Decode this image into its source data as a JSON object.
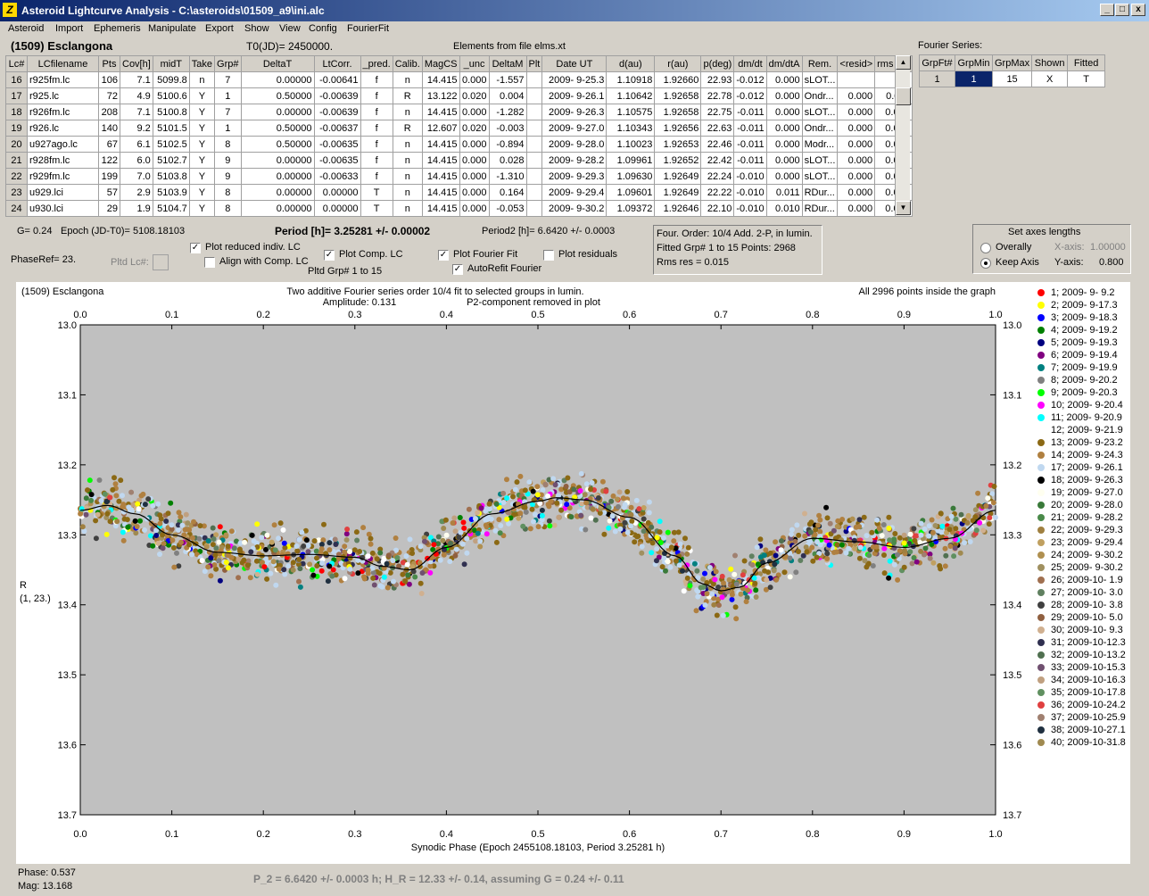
{
  "window": {
    "title": "Asteroid Lightcurve Analysis - C:\\asteroids\\01509_a9\\ini.alc",
    "app_icon": "zigzag-icon",
    "controls": [
      "_",
      "□",
      "x"
    ]
  },
  "menu": [
    "Asteroid",
    "Import",
    "Ephemeris",
    "Manipulate",
    "Export",
    "Show",
    "View",
    "Config",
    "FourierFit"
  ],
  "header": {
    "asteroid": "(1509) Esclangona",
    "t0": "T0(JD)= 2450000.",
    "elements": "Elements from file elms.xt",
    "fourier_title": "Fourier Series:"
  },
  "lc_table": {
    "columns": [
      "Lc#",
      "LCfilename",
      "Pts",
      "Cov[h]",
      "midT",
      "Take",
      "Grp#",
      "DeltaT",
      "LtCorr.",
      "_pred.",
      "Calib.",
      "MagCS",
      "_unc",
      "DeltaM",
      "Plt",
      "Date UT",
      "d(au)",
      "r(au)",
      "p(deg)",
      "dm/dt",
      "dm/dtA",
      "Rem.",
      "<resid>",
      "rms res"
    ],
    "rows": [
      [
        "16",
        "r925fm.lc",
        "106",
        "7.1",
        "5099.8",
        "n",
        "7",
        "0.00000",
        "-0.00641",
        "f",
        "n",
        "14.415",
        "0.000",
        "-1.557",
        "",
        "2009- 9-25.3",
        "1.10918",
        "1.92660",
        "22.93",
        "-0.012",
        "0.000",
        "sLOT...",
        "",
        ""
      ],
      [
        "17",
        "r925.lc",
        "72",
        "4.9",
        "5100.6",
        "Y",
        "1",
        "0.50000",
        "-0.00639",
        "f",
        "R",
        "13.122",
        "0.020",
        "0.004",
        "",
        "2009- 9-26.1",
        "1.10642",
        "1.92658",
        "22.78",
        "-0.012",
        "0.000",
        "Ondr...",
        "0.000",
        "0.011"
      ],
      [
        "18",
        "r926fm.lc",
        "208",
        "7.1",
        "5100.8",
        "Y",
        "7",
        "0.00000",
        "-0.00639",
        "f",
        "n",
        "14.415",
        "0.000",
        "-1.282",
        "",
        "2009- 9-26.3",
        "1.10575",
        "1.92658",
        "22.75",
        "-0.011",
        "0.000",
        "sLOT...",
        "0.000",
        "0.015"
      ],
      [
        "19",
        "r926.lc",
        "140",
        "9.2",
        "5101.5",
        "Y",
        "1",
        "0.50000",
        "-0.00637",
        "f",
        "R",
        "12.607",
        "0.020",
        "-0.003",
        "",
        "2009- 9-27.0",
        "1.10343",
        "1.92656",
        "22.63",
        "-0.011",
        "0.000",
        "Ondr...",
        "0.000",
        "0.010"
      ],
      [
        "20",
        "u927ago.lc",
        "67",
        "6.1",
        "5102.5",
        "Y",
        "8",
        "0.50000",
        "-0.00635",
        "f",
        "n",
        "14.415",
        "0.000",
        "-0.894",
        "",
        "2009- 9-28.0",
        "1.10023",
        "1.92653",
        "22.46",
        "-0.011",
        "0.000",
        "Modr...",
        "0.000",
        "0.008"
      ],
      [
        "21",
        "r928fm.lc",
        "122",
        "6.0",
        "5102.7",
        "Y",
        "9",
        "0.00000",
        "-0.00635",
        "f",
        "n",
        "14.415",
        "0.000",
        "0.028",
        "",
        "2009- 9-28.2",
        "1.09961",
        "1.92652",
        "22.42",
        "-0.011",
        "0.000",
        "sLOT...",
        "0.000",
        "0.019"
      ],
      [
        "22",
        "r929fm.lc",
        "199",
        "7.0",
        "5103.8",
        "Y",
        "9",
        "0.00000",
        "-0.00633",
        "f",
        "n",
        "14.415",
        "0.000",
        "-1.310",
        "",
        "2009- 9-29.3",
        "1.09630",
        "1.92649",
        "22.24",
        "-0.010",
        "0.000",
        "sLOT...",
        "0.000",
        "0.023"
      ],
      [
        "23",
        "u929.lci",
        "57",
        "2.9",
        "5103.9",
        "Y",
        "8",
        "0.00000",
        "0.00000",
        "T",
        "n",
        "14.415",
        "0.000",
        "0.164",
        "",
        "2009- 9-29.4",
        "1.09601",
        "1.92649",
        "22.22",
        "-0.010",
        "0.011",
        "RDur...",
        "0.000",
        "0.013"
      ],
      [
        "24",
        "u930.lci",
        "29",
        "1.9",
        "5104.7",
        "Y",
        "8",
        "0.00000",
        "0.00000",
        "T",
        "n",
        "14.415",
        "0.000",
        "-0.053",
        "",
        "2009- 9-30.2",
        "1.09372",
        "1.92646",
        "22.10",
        "-0.010",
        "0.010",
        "RDur...",
        "0.000",
        "0.013"
      ]
    ]
  },
  "fourier_table": {
    "columns": [
      "GrpFt#",
      "GrpMin",
      "GrpMax",
      "Shown",
      "Fitted"
    ],
    "row": [
      "1",
      "1",
      "15",
      "X",
      "T"
    ]
  },
  "controls": {
    "g": "G= 0.24",
    "epoch": "Epoch (JD-T0)= 5108.18103",
    "period": "Period [h]= 3.25281 +/- 0.00002",
    "period2": "Period2 [h]= 6.6420 +/- 0.0003",
    "phaseref": "PhaseRef= 23.",
    "pltd_lc": "Pltd Lc#:",
    "plot_reduced": "Plot reduced indiv. LC",
    "align_comp": "Align with Comp. LC",
    "plot_comp": "Plot Comp. LC",
    "pltd_grp": "Pltd Grp#  1   to   15",
    "plot_fourier": "Plot Fourier Fit",
    "autorefit": "AutoRefit Fourier",
    "plot_residuals": "Plot residuals",
    "info1": "Four. Order: 10/4     Add. 2-P, in lumin.",
    "info2": "Fitted Grp# 1 to 15   Points: 2968",
    "info3": "Rms res      = 0.015",
    "axes_title": "Set axes lengths",
    "overally": "Overally",
    "keep_axis": "Keep Axis",
    "xaxis_label": "X-axis:",
    "xaxis_val": "1.00000",
    "yaxis_label": "Y-axis:",
    "yaxis_val": "0.800"
  },
  "chart_data": {
    "type": "scatter",
    "title_left": "(1509) Esclangona",
    "title": "Two additive Fourier series order 10/4 fit to selected groups in lumin.",
    "amplitude": "Amplitude: 0.131",
    "p2note": "P2-component removed in plot",
    "points_note": "All 2996 points inside the graph",
    "xlabel": "Synodic Phase (Epoch 2455108.18103, Period 3.25281 h)",
    "ylabel": [
      "R",
      "(1, 23.)"
    ],
    "xlim": [
      0,
      1
    ],
    "ylim": [
      13.7,
      13.0
    ],
    "y_inverted": true,
    "x_ticks": [
      "0.0",
      "0.1",
      "0.2",
      "0.3",
      "0.4",
      "0.5",
      "0.6",
      "0.7",
      "0.8",
      "0.9",
      "1.0"
    ],
    "y_ticks": [
      "13.0",
      "13.1",
      "13.2",
      "13.3",
      "13.4",
      "13.5",
      "13.6",
      "13.7"
    ],
    "grid": false,
    "legend_placement": "right",
    "fit_curve": {
      "x": [
        0,
        0.03,
        0.06,
        0.1,
        0.15,
        0.2,
        0.25,
        0.3,
        0.33,
        0.36,
        0.4,
        0.45,
        0.5,
        0.52,
        0.55,
        0.6,
        0.65,
        0.68,
        0.7,
        0.72,
        0.75,
        0.8,
        0.85,
        0.9,
        0.95,
        1.0
      ],
      "y": [
        13.265,
        13.258,
        13.27,
        13.3,
        13.325,
        13.33,
        13.328,
        13.332,
        13.345,
        13.35,
        13.318,
        13.27,
        13.252,
        13.247,
        13.25,
        13.275,
        13.33,
        13.37,
        13.38,
        13.375,
        13.34,
        13.305,
        13.31,
        13.318,
        13.305,
        13.265
      ]
    },
    "scatter_approx": "~2996 observations scattered around the fit with rms ~0.015 mag",
    "series": [
      {
        "name": "1; 2009- 9- 9.2",
        "color": "#ff0000"
      },
      {
        "name": "2; 2009- 9-17.3",
        "color": "#ffff00"
      },
      {
        "name": "3; 2009- 9-18.3",
        "color": "#0000ff"
      },
      {
        "name": "4; 2009- 9-19.2",
        "color": "#008000"
      },
      {
        "name": "5; 2009- 9-19.3",
        "color": "#000080"
      },
      {
        "name": "6; 2009- 9-19.4",
        "color": "#800080"
      },
      {
        "name": "7; 2009- 9-19.9",
        "color": "#008080"
      },
      {
        "name": "8; 2009- 9-20.2",
        "color": "#808080"
      },
      {
        "name": "9; 2009- 9-20.3",
        "color": "#00ff00"
      },
      {
        "name": "10; 2009- 9-20.4",
        "color": "#ff00ff"
      },
      {
        "name": "11; 2009- 9-20.9",
        "color": "#00ffff"
      },
      {
        "name": "12; 2009- 9-21.9",
        "color": "#ffffff"
      },
      {
        "name": "13; 2009- 9-23.2",
        "color": "#8b6914"
      },
      {
        "name": "14; 2009- 9-24.3",
        "color": "#b08040"
      },
      {
        "name": "17; 2009- 9-26.1",
        "color": "#c0d8f0"
      },
      {
        "name": "18; 2009- 9-26.3",
        "color": "#000000"
      },
      {
        "name": "19; 2009- 9-27.0",
        "color": "#fffff0"
      },
      {
        "name": "20; 2009- 9-28.0",
        "color": "#3a7a3a"
      },
      {
        "name": "21; 2009- 9-28.2",
        "color": "#4a8a4a"
      },
      {
        "name": "22; 2009- 9-29.3",
        "color": "#a08040"
      },
      {
        "name": "23; 2009- 9-29.4",
        "color": "#c0a060"
      },
      {
        "name": "24; 2009- 9-30.2",
        "color": "#b09050"
      },
      {
        "name": "25; 2009- 9-30.2",
        "color": "#a09060"
      },
      {
        "name": "26; 2009-10- 1.9",
        "color": "#a07050"
      },
      {
        "name": "27; 2009-10- 3.0",
        "color": "#608060"
      },
      {
        "name": "28; 2009-10- 3.8",
        "color": "#404040"
      },
      {
        "name": "29; 2009-10- 5.0",
        "color": "#906040"
      },
      {
        "name": "30; 2009-10- 9.3",
        "color": "#d0b090"
      },
      {
        "name": "31; 2009-10-12.3",
        "color": "#303050"
      },
      {
        "name": "32; 2009-10-13.2",
        "color": "#507050"
      },
      {
        "name": "33; 2009-10-15.3",
        "color": "#705070"
      },
      {
        "name": "34; 2009-10-16.3",
        "color": "#c0a080"
      },
      {
        "name": "35; 2009-10-17.8",
        "color": "#609060"
      },
      {
        "name": "36; 2009-10-24.2",
        "color": "#e04040"
      },
      {
        "name": "37; 2009-10-25.9",
        "color": "#a08070"
      },
      {
        "name": "38; 2009-10-27.1",
        "color": "#203040"
      },
      {
        "name": "40; 2009-10-31.8",
        "color": "#a08a50"
      }
    ]
  },
  "status": {
    "phase": "Phase:  0.537",
    "mag": "Mag:   13.168",
    "result": "P_2 = 6.6420 +/- 0.0003 h; H_R = 12.33 +/- 0.14, assuming G = 0.24 +/- 0.11"
  }
}
